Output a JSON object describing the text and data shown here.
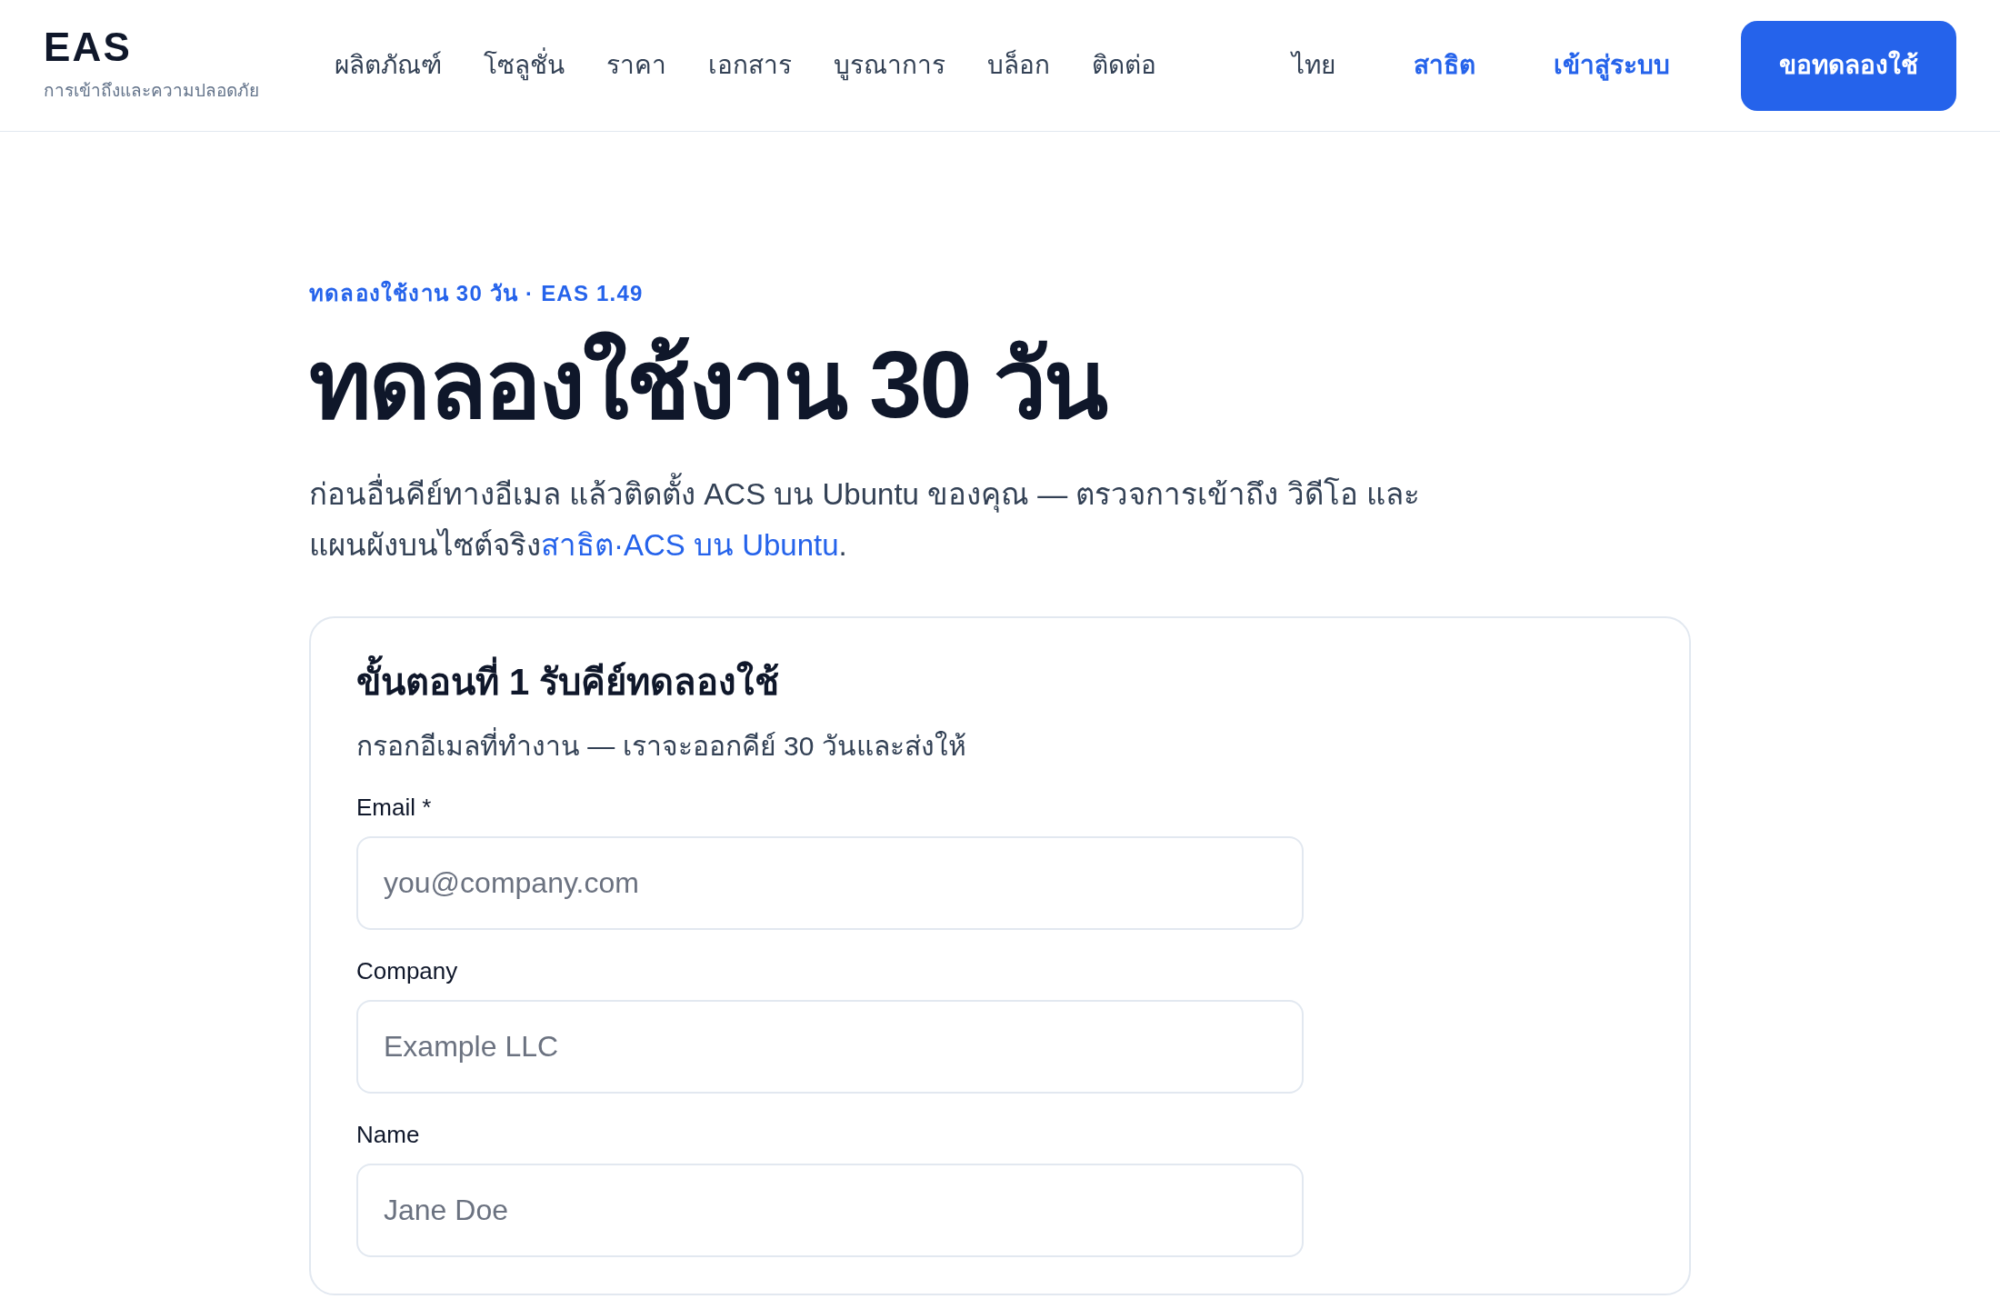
{
  "header": {
    "logo": "EAS",
    "tagline": "การเข้าถึงและความปลอดภัย",
    "nav": [
      "ผลิตภัณฑ์",
      "โซลูชั่น",
      "ราคา",
      "เอกสาร",
      "บูรณาการ",
      "บล็อก",
      "ติดต่อ"
    ],
    "actions": [
      {
        "label": "ไทย",
        "kind": "plain"
      },
      {
        "label": "สาธิต",
        "kind": "link"
      },
      {
        "label": "เข้าสู่ระบบ",
        "kind": "link"
      },
      {
        "label": "ขอทดลองใช้",
        "kind": "primary"
      }
    ]
  },
  "hero": {
    "eyebrow": "ทดลองใช้งาน 30 วัน · EAS 1.49",
    "title": "ทดลองใช้งาน 30 วัน",
    "intro": "ก่อนอื่นคีย์ทางอีเมล แล้วติดตั้ง ACS บน Ubuntu ของคุณ — ตรวจการเข้าถึง วิดีโอ และแผนผังบนไซต์จริง",
    "intro_link": "สาธิต·ACS บน Ubuntu",
    "intro_end": "."
  },
  "card": {
    "title": "ขั้นตอนที่ 1 รับคีย์ทดลองใช้",
    "subtitle": "กรอกอีเมลที่ทำงาน — เราจะออกคีย์ 30 วันและส่งให้",
    "fields": [
      {
        "label": "Email *",
        "placeholder": "you@company.com"
      },
      {
        "label": "Company",
        "placeholder": "Example LLC"
      },
      {
        "label": "Name",
        "placeholder": "Jane Doe"
      }
    ]
  }
}
